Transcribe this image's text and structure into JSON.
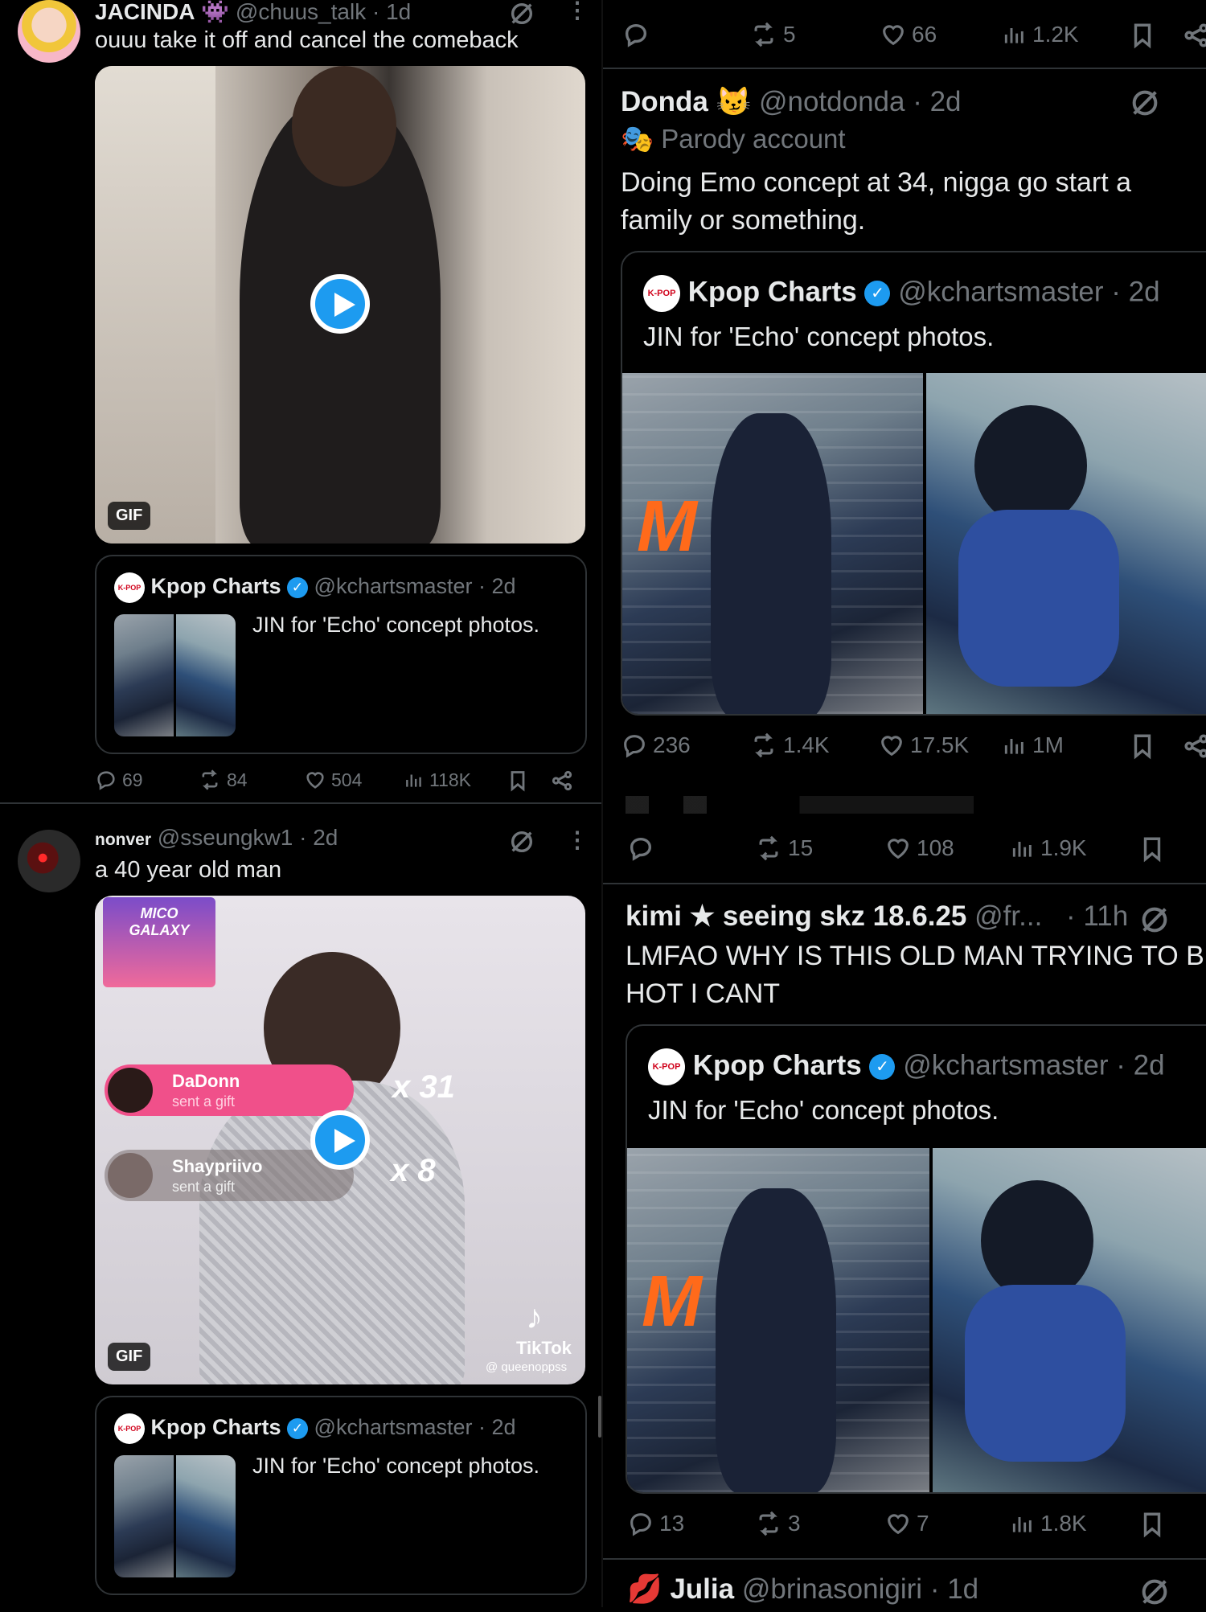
{
  "left_tweet_1": {
    "display_name": "JACINDA",
    "handle": "@chuus_talk",
    "time": "· 1d",
    "text": "ouuu take it off and cancel the comeback",
    "gif_label": "GIF",
    "quote": {
      "name": "Kpop Charts",
      "handle": "@kchartsmaster",
      "time": "· 2d",
      "text": "JIN for 'Echo' concept photos.",
      "logo_text": "K-POP"
    },
    "stats": {
      "replies": "69",
      "reposts": "84",
      "likes": "504",
      "views": "118K"
    }
  },
  "left_tweet_2": {
    "display_name": "nonver",
    "handle": "@sseungkw1",
    "time": "· 2d",
    "text": "a 40 year old man",
    "gif_label": "GIF",
    "overlay": {
      "galaxy": "MICO GALAXY",
      "gift1_name": "DaDonn",
      "gift1_sub": "sent a gift",
      "gift1_count": "x 31",
      "gift2_name": "Shaypriivo",
      "gift2_sub": "sent a gift",
      "gift2_count": "x 8",
      "tiktok": "TikTok",
      "tiktok_user": "@ queenoppss"
    },
    "quote": {
      "name": "Kpop Charts",
      "handle": "@kchartsmaster",
      "time": "· 2d",
      "text": "JIN for 'Echo' concept photos.",
      "logo_text": "K-POP"
    }
  },
  "right_top_stats": {
    "reposts": "5",
    "likes": "66",
    "views": "1.2K"
  },
  "right_tweet_1": {
    "display_name": "Donda",
    "handle": "@notdonda",
    "time": "· 2d",
    "parody_label": "Parody account",
    "text": "Doing Emo concept at 34, nigga go start a family or something.",
    "quote": {
      "name": "Kpop Charts",
      "handle": "@kchartsmaster",
      "time": "· 2d",
      "text": "JIN for 'Echo' concept photos.",
      "logo_text": "K-POP"
    },
    "stats": {
      "replies": "236",
      "reposts": "1.4K",
      "likes": "17.5K",
      "views": "1M"
    }
  },
  "right_mid_stats": {
    "reposts": "15",
    "likes": "108",
    "views": "1.9K"
  },
  "right_tweet_2": {
    "display_name": "kimi ★ seeing skz 18.6.25",
    "handle": "@fr...",
    "time": "· 11h",
    "text": "LMFAO WHY IS THIS OLD MAN TRYING TO B HOT I CANT",
    "quote": {
      "name": "Kpop Charts",
      "handle": "@kchartsmaster",
      "time": "· 2d",
      "text": "JIN for 'Echo' concept photos.",
      "logo_text": "K-POP"
    },
    "stats": {
      "replies": "13",
      "reposts": "3",
      "likes": "7",
      "views": "1.8K"
    }
  },
  "right_tweet_3": {
    "display_name": "Julia",
    "handle": "@brinasonigiri",
    "time": "· 1d"
  },
  "colors": {
    "accent": "#1d9bf0",
    "muted": "#71767b",
    "background": "#000000",
    "border": "#2f3336"
  }
}
